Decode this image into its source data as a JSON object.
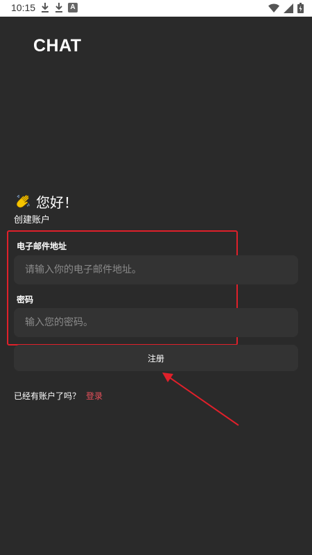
{
  "status_bar": {
    "time": "10:15",
    "left_icons": [
      "download-icon",
      "download-icon",
      "a-icon"
    ],
    "a_icon_label": "A",
    "right_icons": [
      "wifi-icon",
      "signal-icon",
      "battery-icon"
    ]
  },
  "app": {
    "title": "CHAT",
    "greeting": "您好！",
    "subtitle": "创建账户"
  },
  "form": {
    "email_label": "电子邮件地址",
    "email_placeholder": "请输入你的电子邮件地址。",
    "email_value": "",
    "password_label": "密码",
    "password_placeholder": "输入您的密码。",
    "password_value": "",
    "register_label": "注册"
  },
  "footer": {
    "login_prompt": "已经有账户了吗？",
    "login_link": "登录"
  },
  "colors": {
    "background": "#2a2a2a",
    "input_bg": "#333333",
    "link": "#e8505b",
    "annotation": "#e0202a"
  }
}
